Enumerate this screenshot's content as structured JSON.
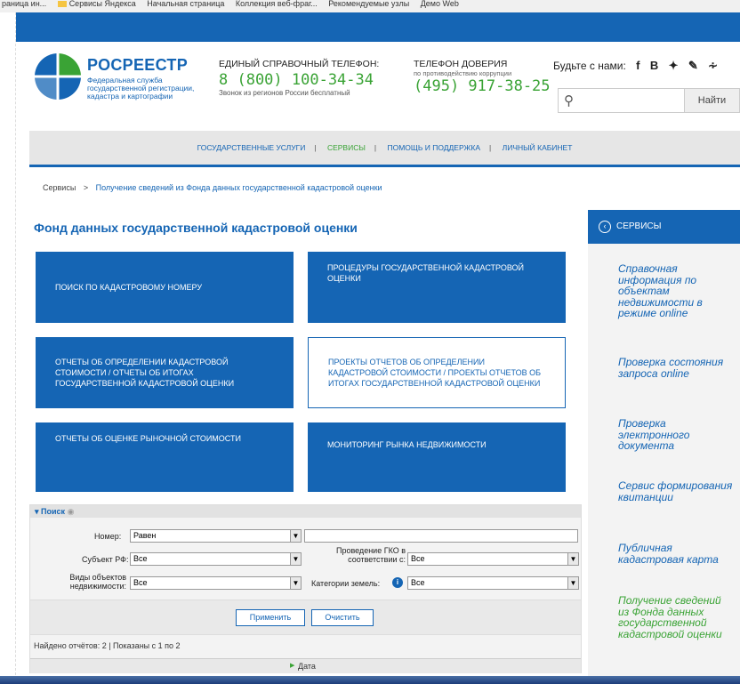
{
  "browser": {
    "bookmarks": [
      "раница ин...",
      "Сервисы Яндекса",
      "Начальная страница",
      "Коллекция веб-фраг...",
      "Рекомендуемые узлы",
      "Демо Web"
    ]
  },
  "header": {
    "brand_name": "РОСРЕЕСТР",
    "brand_sub": "Федеральная служба государственной регистрации, кадастра и картографии",
    "phone1_label": "ЕДИНЫЙ СПРАВОЧНЫЙ ТЕЛЕФОН:",
    "phone1_number": "8 (800) 100-34-34",
    "phone1_note": "Звонок из регионов России бесплатный",
    "phone2_label": "ТЕЛЕФОН ДОВЕРИЯ",
    "phone2_sub": "по противодействию коррупции",
    "phone2_number": "(495) 917-38-25",
    "social_label": "Будьте с нами:",
    "social_icons": [
      "f",
      "B",
      "✔",
      "✎",
      "ᵊ"
    ],
    "search_placeholder": "",
    "search_button": "Найти"
  },
  "nav": {
    "items": [
      "ГОСУДАРСТВЕННЫЕ УСЛУГИ",
      "СЕРВИСЫ",
      "ПОМОЩЬ И ПОДДЕРЖКА",
      "ЛИЧНЫЙ КАБИНЕТ"
    ],
    "active_index": 1
  },
  "breadcrumb": {
    "root": "Сервисы",
    "separator": ">",
    "current": "Получение сведений из Фонда данных государственной кадастровой оценки"
  },
  "page_title": "Фонд данных государственной кадастровой оценки",
  "tiles": [
    "ПОИСК ПО КАДАСТРОВОМУ НОМЕРУ",
    "ПРОЦЕДУРЫ ГОСУДАРСТВЕННОЙ КАДАСТРОВОЙ ОЦЕНКИ",
    "ОТЧЕТЫ ОБ ОПРЕДЕЛЕНИИ КАДАСТРОВОЙ СТОИМОСТИ / ОТЧЕТЫ ОБ ИТОГАХ ГОСУДАРСТВЕННОЙ КАДАСТРОВОЙ ОЦЕНКИ",
    "ПРОЕКТЫ ОТЧЕТОВ ОБ ОПРЕДЕЛЕНИИ КАДАСТРОВОЙ СТОИМОСТИ / ПРОЕКТЫ ОТЧЕТОВ ОБ ИТОГАХ ГОСУДАРСТВЕННОЙ КАДАСТРОВОЙ ОЦЕНКИ",
    "ОТЧЕТЫ ОБ ОЦЕНКЕ РЫНОЧНОЙ СТОИМОСТИ",
    "МОНИТОРИНГ РЫНКА НЕДВИЖИМОСТИ"
  ],
  "filters": {
    "panel_title": "Поиск",
    "number_label": "Номер:",
    "number_mode": "Равен",
    "number_value": "",
    "subject_label": "Субъект РФ:",
    "subject_value": "Все",
    "gko_label": "Проведение ГКО в соответствии с:",
    "gko_value": "Все",
    "objects_label": "Виды объектов недвижимости:",
    "objects_value": "Все",
    "land_label": "Категории земель:",
    "land_value": "Все",
    "apply_button": "Применить",
    "clear_button": "Очистить",
    "found_text": "Найдено отчётов: 2 | Показаны с 1 по 2",
    "column_date": "Дата"
  },
  "sidebar": {
    "title": "СЕРВИСЫ",
    "items": [
      "Справочная информация по объектам недвижимости в режиме online",
      "Проверка состояния запроса online",
      "Проверка электронного документа",
      "Сервис формирования квитанции",
      "Публичная кадастровая карта",
      "Получение сведений из Фонда данных государственной кадастровой оценки"
    ]
  },
  "colors": {
    "brand_blue": "#1565b4",
    "accent_green": "#3aa335"
  }
}
